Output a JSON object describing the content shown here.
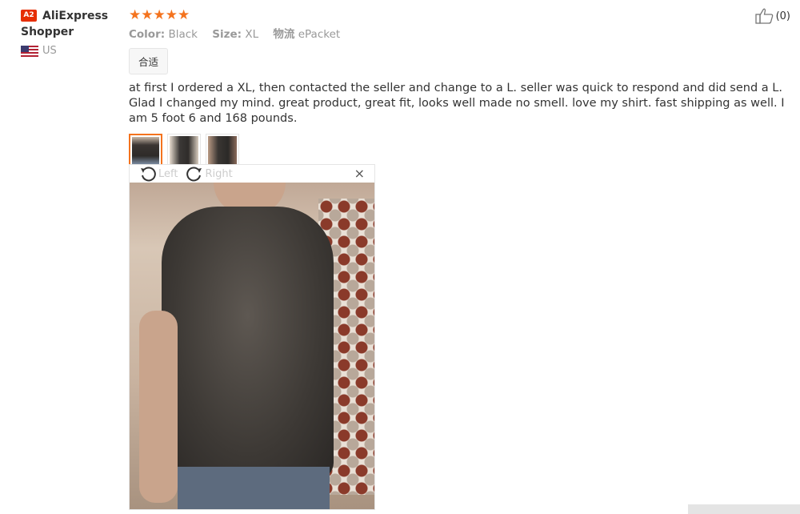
{
  "user": {
    "badge": "A2",
    "name_line1": "AliExpress",
    "name_line2": "Shopper",
    "country": "US"
  },
  "review": {
    "rating": 5,
    "stars": "★★★★★",
    "attributes": [
      {
        "key": "Color:",
        "value": "Black"
      },
      {
        "key": "Size:",
        "value": "XL"
      },
      {
        "key": "物流",
        "value": "ePacket"
      }
    ],
    "tag": "合适",
    "text": "at first I ordered a XL, then contacted the seller and change to a L. seller was quick to respond and did send a L. Glad I changed my mind. great product, great fit, looks well made no smell. love my shirt. fast shipping as well. I am 5 foot 6 and 168 pounds.",
    "thumbnails": 3,
    "likes": "(0)"
  },
  "viewer": {
    "rotate_left": "Left",
    "rotate_right": "Right",
    "close": "×"
  }
}
